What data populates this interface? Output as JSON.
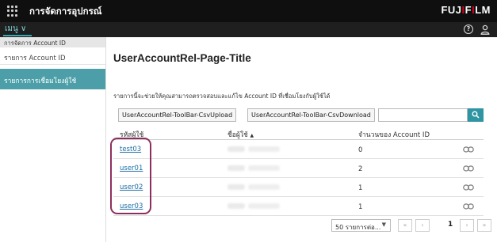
{
  "header": {
    "app_title": "การจัดการอุปกรณ์",
    "logo": "FUJIFILM"
  },
  "menubar": {
    "menu_label": "เมนู ∨"
  },
  "sidebar": {
    "section_title": "การจัดการ Account ID",
    "items": [
      {
        "label": "รายการ Account ID",
        "active": false
      },
      {
        "label": "รายการการเชื่อมโยงผู้ใช้",
        "active": true
      }
    ]
  },
  "main": {
    "title": "UserAccountRel-Page-Title",
    "description": "รายการนี้จะช่วยให้คุณสามารถตรวจสอบและแก้ไข Account ID ที่เชื่อมโยงกับผู้ใช้ได้",
    "toolbar": {
      "upload_label": "UserAccountRel-ToolBar-CsvUpload",
      "download_label": "UserAccountRel-ToolBar-CsvDownload",
      "search_value": ""
    },
    "table": {
      "columns": [
        "รหัสผู้ใช้",
        "ชื่อผู้ใช้",
        "จำนวนของ Account ID"
      ],
      "sort_indicator": "▲",
      "rows": [
        {
          "user_id": "test03",
          "count": "0"
        },
        {
          "user_id": "user01",
          "count": "2"
        },
        {
          "user_id": "user02",
          "count": "1"
        },
        {
          "user_id": "user03",
          "count": "1"
        }
      ]
    },
    "pager": {
      "per_page": "50 รายการต่อ...",
      "first": "«",
      "prev": "‹",
      "page": "1",
      "next": "›",
      "last": "»"
    }
  },
  "colors": {
    "accent": "#4c9fa8",
    "highlight_oval": "#8d2f5d",
    "link": "#1d6fa5"
  }
}
